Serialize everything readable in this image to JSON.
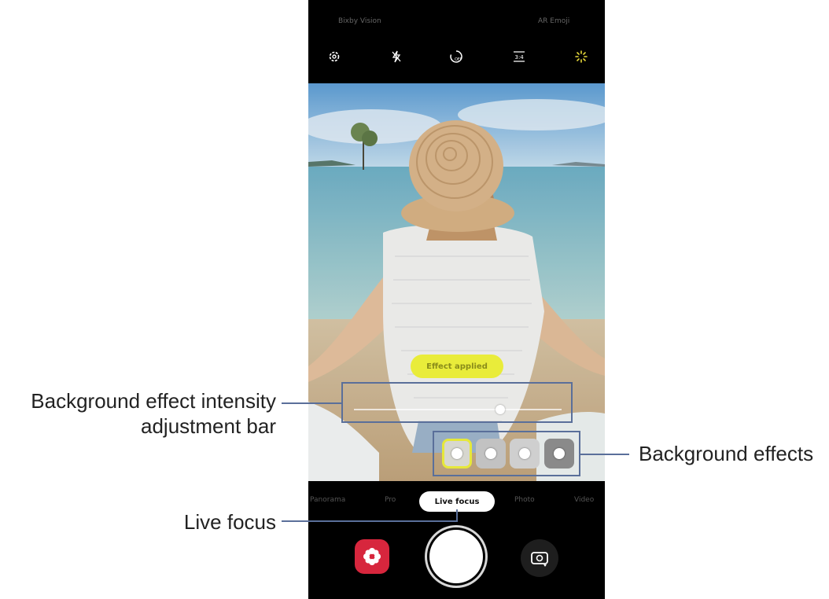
{
  "camera": {
    "top_labels": {
      "left": "Bixby Vision",
      "right": "AR Emoji"
    },
    "icons": [
      {
        "name": "settings-icon"
      },
      {
        "name": "flash-off-icon"
      },
      {
        "name": "timer-off-icon"
      },
      {
        "name": "aspect-ratio-icon",
        "label": "3:4"
      },
      {
        "name": "filters-icon",
        "color": "#e6d83a"
      }
    ],
    "effect_pill": "Effect applied",
    "intensity": {
      "value_fraction": 0.71
    },
    "effects": [
      {
        "name": "effect-blur",
        "selected": true,
        "color": "#d7d7cf"
      },
      {
        "name": "effect-big-circle",
        "selected": false,
        "color": "#c2c2c2"
      },
      {
        "name": "effect-color-point",
        "selected": false,
        "color": "#cfcfcf"
      },
      {
        "name": "effect-zoom",
        "selected": false,
        "color": "#8a8a8a"
      }
    ],
    "modes": [
      "Panorama",
      "Pro",
      "Live focus",
      "Photo",
      "Video"
    ],
    "active_mode": "Live focus"
  },
  "callouts": {
    "intensity_bar_line1": "Background effect intensity",
    "intensity_bar_line2": "adjustment bar",
    "effects": "Background effects",
    "live_focus": "Live focus"
  },
  "colors": {
    "callout": "#5a6f9a",
    "selected_effect_border": "#e6e83a",
    "bixby": "#d7263d"
  }
}
